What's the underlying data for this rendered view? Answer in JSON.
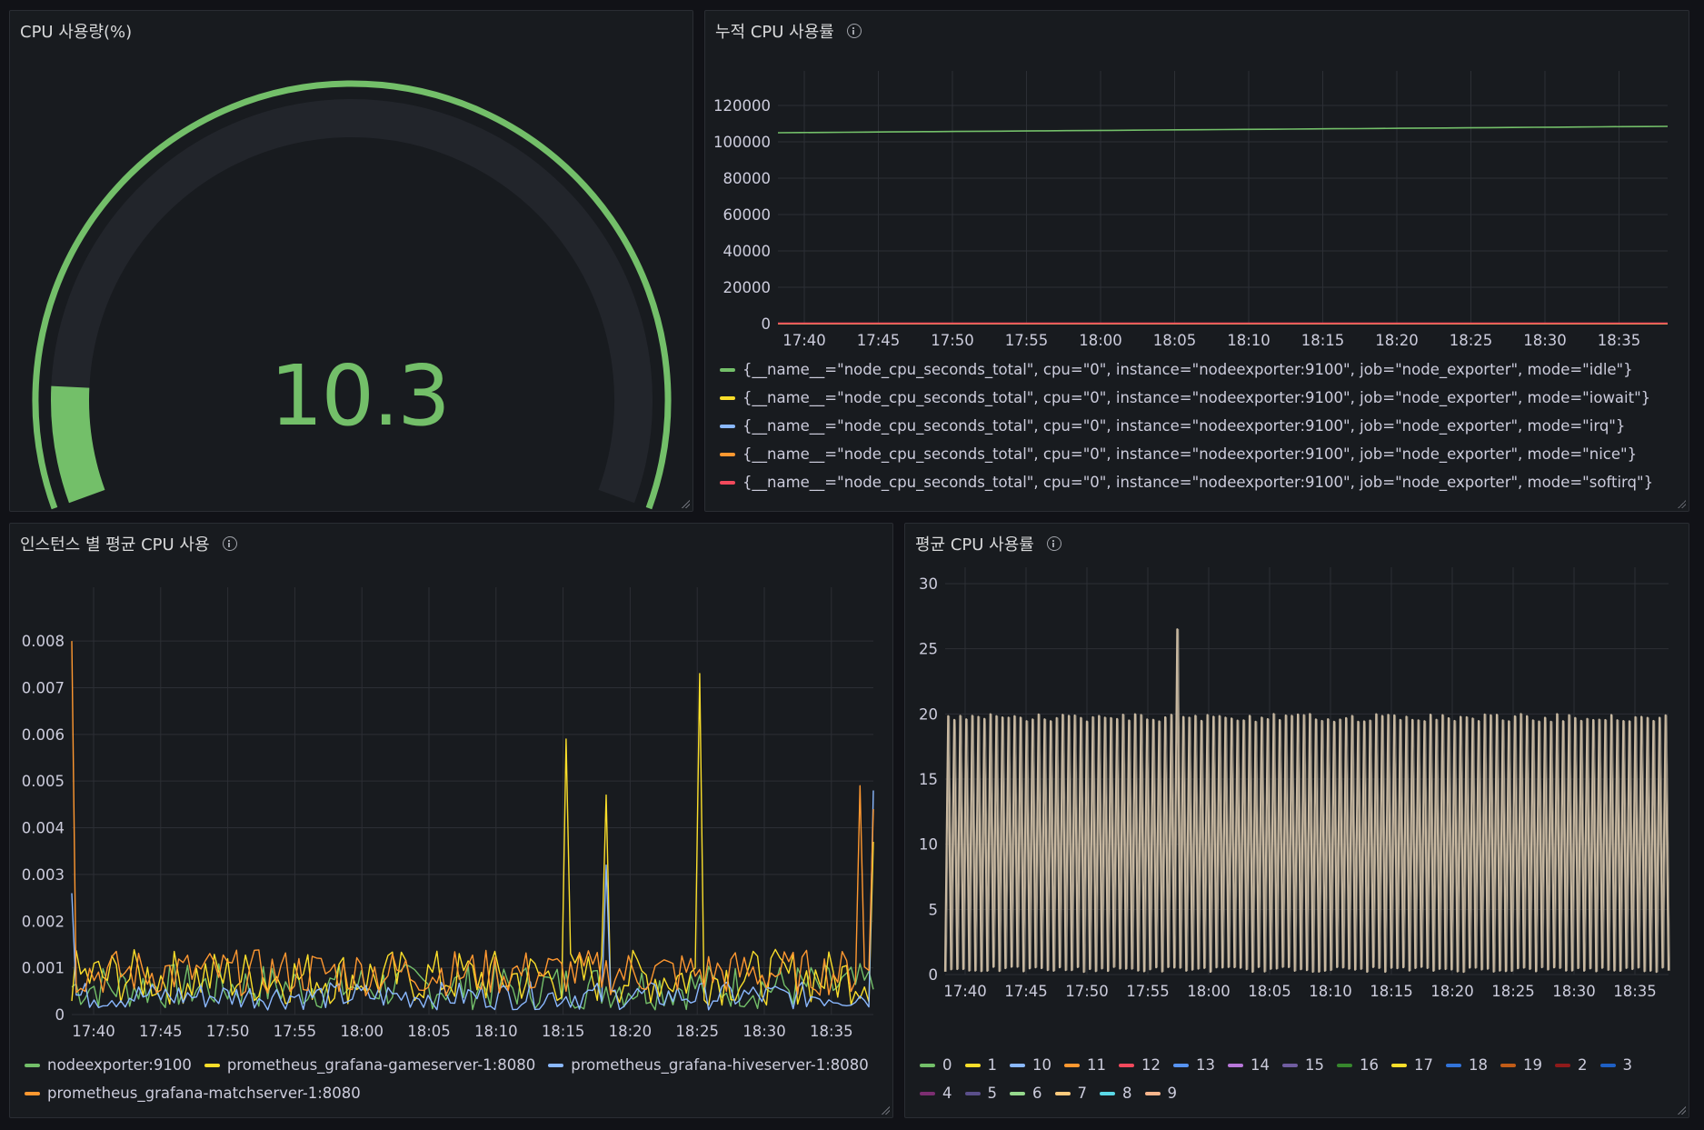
{
  "panels": {
    "gauge": {
      "title": "CPU 사용량(%)",
      "value": "10.3",
      "value_number": 10.3,
      "min": 0,
      "max": 100,
      "color": "#73bf69",
      "track_color": "#22252b"
    },
    "cumulative": {
      "title": "누적 CPU 사용률"
    },
    "instance_avg": {
      "title": "인스턴스 별 평균 CPU 사용"
    },
    "avg": {
      "title": "평균 CPU 사용률"
    }
  },
  "chart_data": [
    {
      "id": "cumulative",
      "type": "line",
      "x_ticks": [
        "17:40",
        "17:45",
        "17:50",
        "17:55",
        "18:00",
        "18:05",
        "18:10",
        "18:15",
        "18:20",
        "18:25",
        "18:30",
        "18:35"
      ],
      "y_ticks": [
        0,
        20000,
        40000,
        60000,
        80000,
        100000,
        120000
      ],
      "ylim": [
        0,
        130000
      ],
      "grid": true,
      "legend_position": "bottom",
      "series": [
        {
          "name": "{__name__=\"node_cpu_seconds_total\", cpu=\"0\", instance=\"nodeexporter:9100\", job=\"node_exporter\", mode=\"idle\"}",
          "color": "#73bf69",
          "start": 105000,
          "end": 108500
        },
        {
          "name": "{__name__=\"node_cpu_seconds_total\", cpu=\"0\", instance=\"nodeexporter:9100\", job=\"node_exporter\", mode=\"iowait\"}",
          "color": "#fade2a",
          "start": 15,
          "end": 20
        },
        {
          "name": "{__name__=\"node_cpu_seconds_total\", cpu=\"0\", instance=\"nodeexporter:9100\", job=\"node_exporter\", mode=\"irq\"}",
          "color": "#8ab8ff",
          "start": 0,
          "end": 0
        },
        {
          "name": "{__name__=\"node_cpu_seconds_total\", cpu=\"0\", instance=\"nodeexporter:9100\", job=\"node_exporter\", mode=\"nice\"}",
          "color": "#ff9830",
          "start": 0,
          "end": 0
        },
        {
          "name": "{__name__=\"node_cpu_seconds_total\", cpu=\"0\", instance=\"nodeexporter:9100\", job=\"node_exporter\", mode=\"softirq\"}",
          "color": "#f2495c",
          "start": 210,
          "end": 230
        }
      ]
    },
    {
      "id": "instance_avg",
      "type": "line",
      "x_ticks": [
        "17:40",
        "17:45",
        "17:50",
        "17:55",
        "18:00",
        "18:05",
        "18:10",
        "18:15",
        "18:20",
        "18:25",
        "18:30",
        "18:35"
      ],
      "y_ticks": [
        0,
        0.001,
        0.002,
        0.003,
        0.004,
        0.005,
        0.006,
        0.007,
        0.008
      ],
      "y_tick_labels": [
        "0",
        "0.001",
        "0.002",
        "0.003",
        "0.004",
        "0.005",
        "0.006",
        "0.007",
        "0.008"
      ],
      "ylim": [
        0,
        0.0088
      ],
      "grid": true,
      "legend_position": "bottom",
      "series": [
        {
          "name": "nodeexporter:9100",
          "color": "#73bf69",
          "base": 0.0006,
          "noise": 0.0005
        },
        {
          "name": "prometheus_grafana-gameserver-1:8080",
          "color": "#fade2a",
          "base": 0.0008,
          "noise": 0.0006,
          "spikes": [
            [
              17.75,
              0.0059
            ],
            [
              17.85,
              0.0073
            ],
            [
              18.18,
              0.0047
            ],
            [
              18.41,
              0.0043
            ],
            [
              18.5,
              0.0037
            ]
          ]
        },
        {
          "name": "prometheus_grafana-hiveserver-1:8080",
          "color": "#8ab8ff",
          "base": 0.0004,
          "noise": 0.0003,
          "spikes": [
            [
              17.33,
              0.0026
            ],
            [
              17.78,
              0.0032
            ],
            [
              18.59,
              0.0048
            ]
          ]
        },
        {
          "name": "prometheus_grafana-matchserver-1:8080",
          "color": "#ff9830",
          "base": 0.0009,
          "noise": 0.0005,
          "spikes": [
            [
              17.33,
              0.008
            ],
            [
              18.37,
              0.0049
            ],
            [
              18.49,
              0.0043
            ],
            [
              18.57,
              0.006
            ],
            [
              18.59,
              0.0044
            ]
          ]
        }
      ]
    },
    {
      "id": "avg",
      "type": "line",
      "x_ticks": [
        "17:40",
        "17:45",
        "17:50",
        "17:55",
        "18:00",
        "18:05",
        "18:10",
        "18:15",
        "18:20",
        "18:25",
        "18:30",
        "18:35"
      ],
      "y_ticks": [
        0,
        5,
        10,
        15,
        20,
        25,
        30
      ],
      "ylim": [
        0,
        30
      ],
      "grid": true,
      "legend_position": "bottom",
      "peak": 20,
      "spike": 26.5,
      "series": [
        {
          "name": "0",
          "color": "#73bf69"
        },
        {
          "name": "1",
          "color": "#fade2a"
        },
        {
          "name": "10",
          "color": "#8ab8ff"
        },
        {
          "name": "11",
          "color": "#ff9830"
        },
        {
          "name": "12",
          "color": "#f2495c"
        },
        {
          "name": "13",
          "color": "#5794f2"
        },
        {
          "name": "14",
          "color": "#b877d9"
        },
        {
          "name": "15",
          "color": "#705da0"
        },
        {
          "name": "16",
          "color": "#37872d"
        },
        {
          "name": "17",
          "color": "#fade2a"
        },
        {
          "name": "18",
          "color": "#3274d9"
        },
        {
          "name": "19",
          "color": "#c15c17"
        },
        {
          "name": "2",
          "color": "#8f1a1a"
        },
        {
          "name": "3",
          "color": "#1f60c4"
        },
        {
          "name": "4",
          "color": "#7c2e71"
        },
        {
          "name": "5",
          "color": "#5a4f8a"
        },
        {
          "name": "6",
          "color": "#96d98d"
        },
        {
          "name": "7",
          "color": "#ffcb7d"
        },
        {
          "name": "8",
          "color": "#5ad8e6"
        },
        {
          "name": "9",
          "color": "#f9b58c"
        }
      ]
    }
  ]
}
